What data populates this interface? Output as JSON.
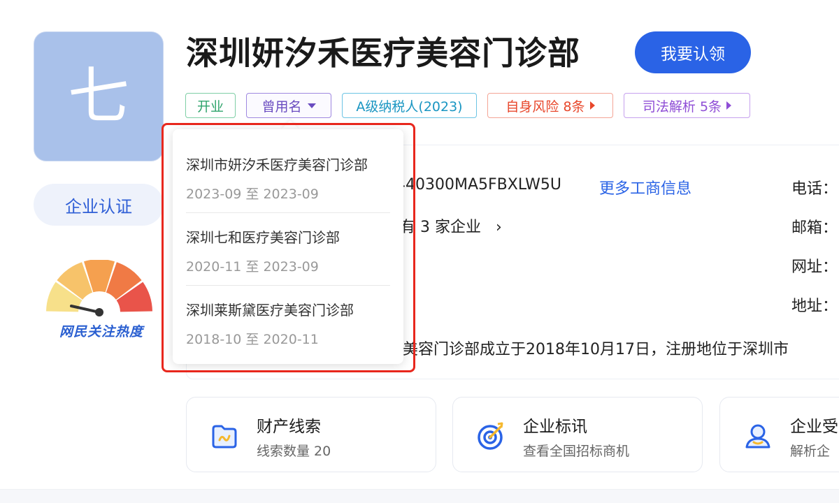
{
  "logo": {
    "char": "七"
  },
  "sidebar": {
    "cert_label": "企业认证",
    "heat_label": "网民关注热度",
    "heat_colors": [
      "#f7e08a",
      "#f7c36a",
      "#f5a04f",
      "#f07a45",
      "#e9544a"
    ]
  },
  "header": {
    "company_name": "深圳妍汐禾医疗美容门诊部",
    "claim_label": "我要认领"
  },
  "tags": {
    "open": "开业",
    "former_names": "曾用名",
    "tax": "A级纳税人(2023)",
    "risk": "自身风险 8条",
    "judicial": "司法解析 5条"
  },
  "former_names_dropdown": [
    {
      "name": "深圳市妍汐禾医疗美容门诊部",
      "period": "2023-09 至 2023-09"
    },
    {
      "name": "深圳七和医疗美容门诊部",
      "period": "2020-11 至 2023-09"
    },
    {
      "name": "深圳莱斯黛医疗美容门诊部",
      "period": "2018-10 至 2020-11"
    }
  ],
  "info": {
    "credit_code_partial": "440300MA5FBXLW5U",
    "more_link": "更多工商信息",
    "related_partial": "有 3 家企业",
    "intro_partial": "美容门诊部成立于2018年10月17日，注册地位于深圳市"
  },
  "contact_labels": {
    "phone": "电话：",
    "email": "邮箱：",
    "website": "网址：",
    "address": "地址："
  },
  "bottom_cards": [
    {
      "title": "财产线索",
      "subtitle": "线索数量 20",
      "icon": "folder-icon"
    },
    {
      "title": "企业标讯",
      "subtitle": "查看全国招标商机",
      "icon": "target-icon"
    },
    {
      "title": "企业受",
      "subtitle": "解析企",
      "icon": "person-icon"
    }
  ],
  "colors": {
    "accent": "#2a63e6",
    "highlight": "#e8271d"
  }
}
